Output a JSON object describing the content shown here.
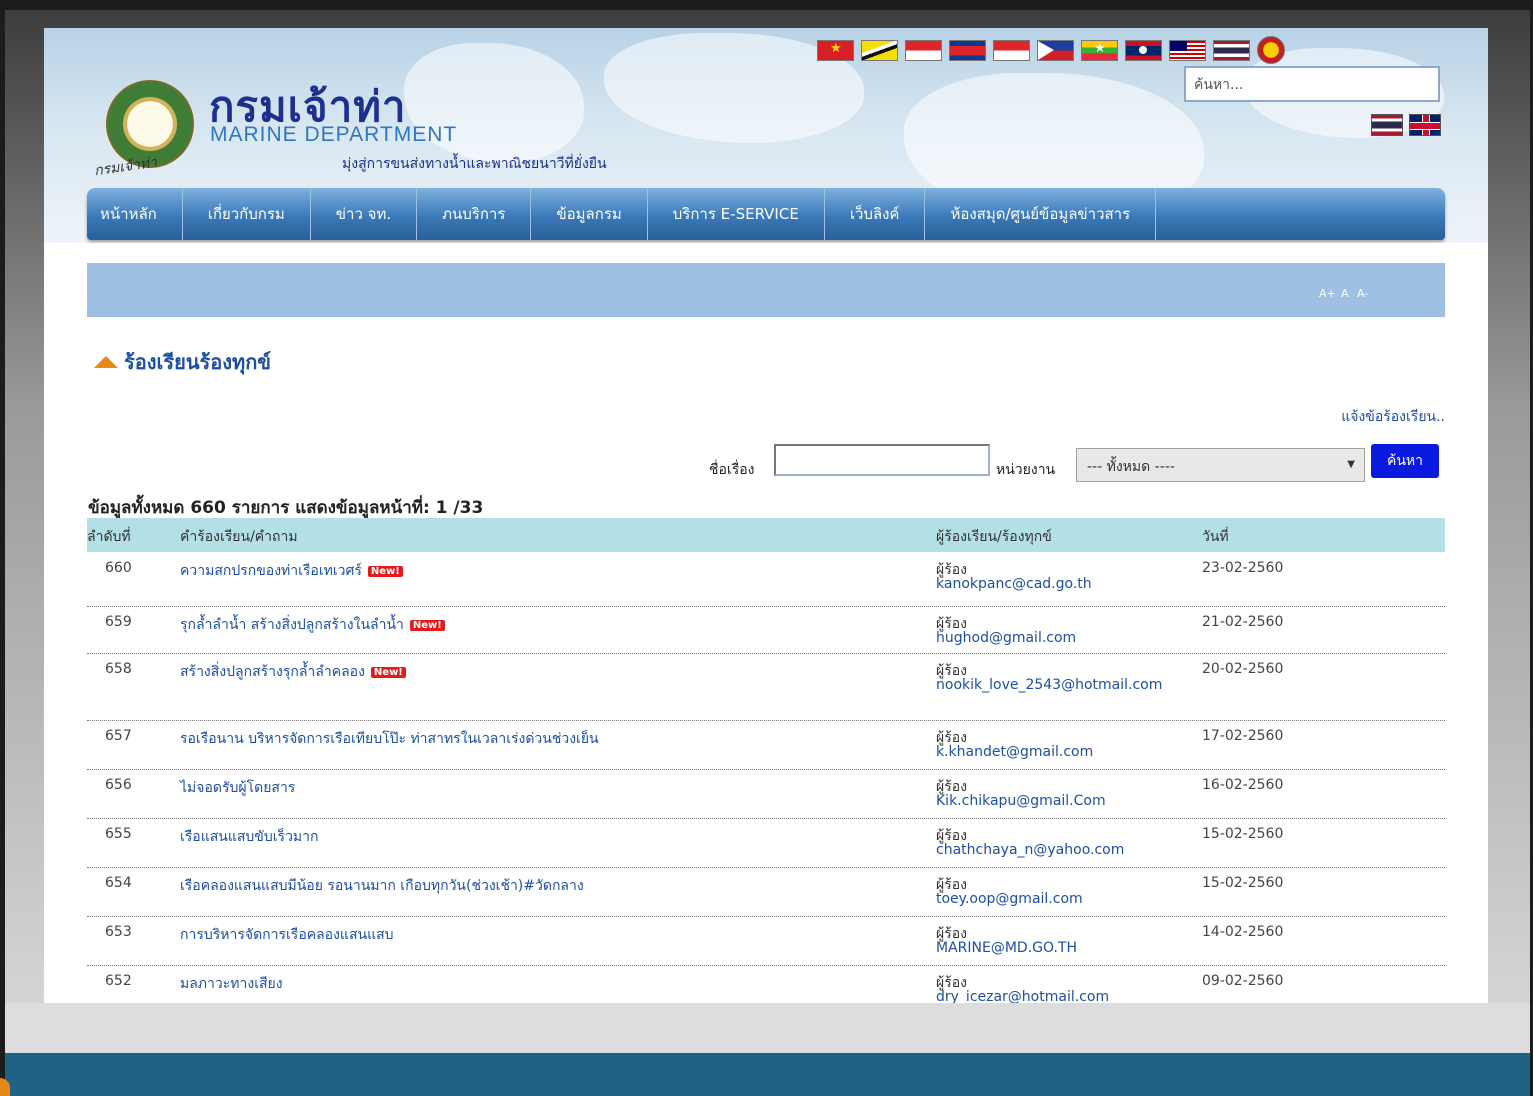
{
  "header": {
    "logo_script": "กรมเจ้าท่า",
    "title_th": "กรมเจ้าท่า",
    "title_en": "MARINE DEPARTMENT",
    "slogan": "มุ่งสู่การขนส่งทางน้ำและพาณิชยนาวีที่ยั่งยืน",
    "search_placeholder": "ค้นหา..."
  },
  "flags": [
    "vietnam-flag",
    "brunei-flag",
    "singapore-flag",
    "cambodia-flag",
    "indonesia-flag",
    "philippines-flag",
    "myanmar-flag",
    "laos-flag",
    "malaysia-flag",
    "thailand-flag",
    "asean-emblem"
  ],
  "languages": [
    "thai-flag",
    "uk-flag"
  ],
  "nav": [
    "หน้าหลัก",
    "เกี่ยวกับกรม",
    "ข่าว จท.",
    "ภนบริการ",
    "ข้อมูลกรม",
    "บริการ E-SERVICE",
    "เว็บลิงค์",
    "ห้องสมุด/ศูนย์ข้อมูลข่าวสาร"
  ],
  "font_sizes": [
    "A+",
    "A",
    "A-"
  ],
  "section": {
    "title": "ร้องเรียนร้องทุกข์",
    "report_link": "แจ้งข้อร้องเรียน.."
  },
  "filter": {
    "subject_label": "ชื่อเรื่อง",
    "subject_value": "",
    "agency_label": "หน่วยงาน",
    "agency_selected": "--- ทั้งหมด ----",
    "search_button": "ค้นหา"
  },
  "summary": "ข้อมูลทั้งหมด 660 รายการ แสดงข้อมูลหน้าที่: 1 /33",
  "table": {
    "headers": [
      "ลำดับที่",
      "คำร้องเรียน/คำถาม",
      "ผู้ร้องเรียน/ร้องทุกข์",
      "วันที่"
    ],
    "requester_prefix": "ผู้ร้อง",
    "new_label": "New!",
    "rows": [
      {
        "no": "660",
        "topic": "ความสกปรกของท่าเรือเทเวศร์",
        "new": true,
        "email": "kanokpanc@cad.go.th",
        "date": "23-02-2560"
      },
      {
        "no": "659",
        "topic": "รุกล้ำลำน้ำ สร้างสิ่งปลูกสร้างในลำน้ำ",
        "new": true,
        "email": "hughod@gmail.com",
        "date": "21-02-2560"
      },
      {
        "no": "658",
        "topic": "สร้างสิ่งปลูกสร้างรุกล้ำลำคลอง",
        "new": true,
        "email": "nookik_love_2543@hotmail.com",
        "date": "20-02-2560"
      },
      {
        "no": "657",
        "topic": "รอเรือนาน บริหารจัดการเรือเทียบโป๊ะ ท่าสาทรในเวลาเร่งด่วนช่วงเย็น",
        "new": false,
        "email": "k.khandet@gmail.com",
        "date": "17-02-2560"
      },
      {
        "no": "656",
        "topic": "ไม่จอดรับผู้โดยสาร",
        "new": false,
        "email": "Kik.chikapu@gmail.Com",
        "date": "16-02-2560"
      },
      {
        "no": "655",
        "topic": "เรือแสนแสบขับเร็วมาก",
        "new": false,
        "email": "chathchaya_n@yahoo.com",
        "date": "15-02-2560"
      },
      {
        "no": "654",
        "topic": "เรือคลองแสนแสบมีน้อย รอนานมาก เกือบทุกวัน(ช่วงเช้า)#วัดกลาง",
        "new": false,
        "email": "toey.oop@gmail.com",
        "date": "15-02-2560"
      },
      {
        "no": "653",
        "topic": "การบริหารจัดการเรือคลองแสนแสบ",
        "new": false,
        "email": "MARINE@MD.GO.TH",
        "date": "14-02-2560"
      },
      {
        "no": "652",
        "topic": "มลภาวะทางเสียง",
        "new": false,
        "email": "dry_icezar@hotmail.com",
        "date": "09-02-2560"
      }
    ]
  }
}
